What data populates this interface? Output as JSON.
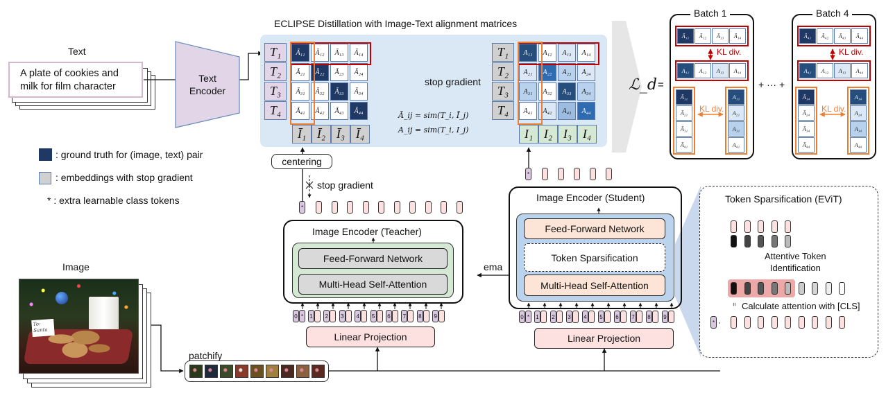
{
  "text_input": {
    "heading": "Text",
    "caption_line1": "A plate of cookies and",
    "caption_line2": "milk for film character"
  },
  "text_encoder": {
    "line1": "Text",
    "line2": "Encoder"
  },
  "distill": {
    "title": "ECLIPSE Distillation with Image-Text alignment matrices",
    "stop_gradient": "stop gradient",
    "eq1": "Ā_ij = sim(T_i, Ī_j)",
    "eq2": "A_ij = sim(T_i, I_j)",
    "teacher_text_labels": [
      "T₁",
      "T₂",
      "T₃",
      "T₄"
    ],
    "teacher_image_labels": [
      "Ī₁",
      "Ī₂",
      "Ī₃",
      "Ī₄"
    ],
    "student_text_labels": [
      "T₁",
      "T₂",
      "T₃",
      "T₄"
    ],
    "student_image_labels": [
      "I₁",
      "I₂",
      "I₃",
      "I₄"
    ],
    "teacher_matrix": [
      [
        "Ā₁₁",
        "Ā₁₂",
        "Ā₁₃",
        "Ā₁₄"
      ],
      [
        "Ā₂₁",
        "Ā₂₂",
        "Ā₂₃",
        "Ā₂₄"
      ],
      [
        "Ā₃₁",
        "Ā₃₂",
        "Ā₃₃",
        "Ā₃₄"
      ],
      [
        "Ā₄₁",
        "Ā₄₂",
        "Ā₄₃",
        "Ā₄₄"
      ]
    ],
    "teacher_shade": [
      [
        "dark",
        "",
        "",
        ""
      ],
      [
        "",
        "dark",
        "",
        ""
      ],
      [
        "",
        "",
        "dark",
        ""
      ],
      [
        "",
        "",
        "",
        "dark"
      ]
    ],
    "student_matrix": [
      [
        "A₁₁",
        "A₁₂",
        "A₁₃",
        "A₁₄"
      ],
      [
        "A₂₁",
        "A₂₂",
        "A₂₃",
        "A₂₄"
      ],
      [
        "A₃₁",
        "A₃₂",
        "A₃₃",
        "A₃₄"
      ],
      [
        "A₄₁",
        "A₄₂",
        "A₄₃",
        "A₄₄"
      ]
    ],
    "student_shade": [
      [
        "dk2",
        "",
        "l1",
        ""
      ],
      [
        "l1",
        "mid",
        "l2",
        "l1"
      ],
      [
        "l2",
        "",
        "dk2",
        "l2"
      ],
      [
        "",
        "l1",
        "l3",
        "mid"
      ]
    ]
  },
  "loss": {
    "symbol": "ℒ_d",
    "equals": "=",
    "plus_dots": "+ ··· +",
    "kl_label": "KL div.",
    "batches": [
      {
        "title": "Batch 1",
        "row_teacher": [
          "Ā₁₁",
          "Ā₁₂",
          "Ā₁₃",
          "Ā₁₄"
        ],
        "row_student": [
          "A₁₁",
          "A₁₂",
          "A₁₃",
          "A₁₄"
        ],
        "col_teacher": [
          "Ā₁₁",
          "Ā₂₁",
          "Ā₃₁",
          "Ā₄₁"
        ],
        "col_student": [
          "A₁₁",
          "A₂₁",
          "A₃₁",
          "A₄₁"
        ]
      },
      {
        "title": "Batch 4",
        "row_teacher": [
          "Ā₄₁",
          "Ā₄₂",
          "Ā₄₃",
          "Ā₄₄"
        ],
        "row_student": [
          "A₄₁",
          "A₁₂",
          "A₁₃",
          "A₄₄"
        ],
        "col_teacher": [
          "Ā₁₄",
          "Ā₂₄",
          "Ā₃₄",
          "Ā₄₄"
        ],
        "col_student": [
          "A₁₄",
          "A₂₄",
          "A₃₄",
          "A₄₄"
        ]
      }
    ]
  },
  "legend": {
    "ground_truth": ": ground truth for (image, text) pair",
    "stop_grad": ": embeddings with stop gradient",
    "class_token": "* : extra learnable class tokens",
    "colors": {
      "ground_truth": "#1f3864",
      "stop_grad": "#d0d0d0"
    }
  },
  "teacher": {
    "centering": "centering",
    "stop_gradient": "stop gradient",
    "title": "Image Encoder (Teacher)",
    "ffn": "Feed-Forward Network",
    "mhsa": "Multi-Head Self-Attention",
    "linear": "Linear Projection",
    "ema": "ema"
  },
  "student": {
    "title": "Image Encoder (Student)",
    "ffn": "Feed-Forward Network",
    "sparsification": "Token Sparsification",
    "mhsa": "Multi-Head Self-Attention",
    "linear": "Linear Projection"
  },
  "evit": {
    "title": "Token Sparsification (EViT)",
    "attentive": "Attentive Token",
    "identification": "Identification",
    "calc": "Calculate attention with [CLS]",
    "equals_mark": "=",
    "dot": "·"
  },
  "image_input": {
    "heading": "Image",
    "note_line1": "To:",
    "note_line2": "Santa"
  },
  "patchify": {
    "label": "patchify"
  },
  "position_ids": [
    "0",
    "*",
    "1",
    "2",
    "3",
    "4",
    "5",
    "6",
    "7",
    "8",
    "9"
  ]
}
